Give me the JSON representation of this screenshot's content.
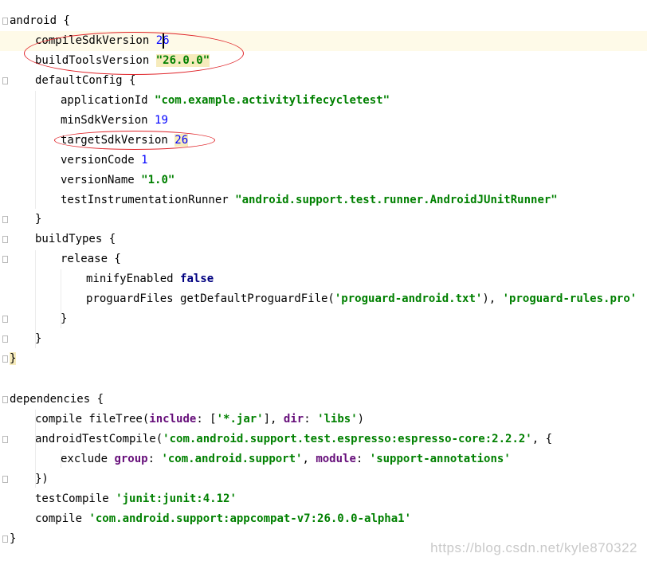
{
  "lines": [
    {
      "parts": [
        {
          "t": "android {"
        }
      ]
    },
    {
      "parts": [
        {
          "t": "compileSdkVersion "
        },
        {
          "t": "26",
          "c": "num"
        }
      ]
    },
    {
      "parts": [
        {
          "t": "buildToolsVersion "
        },
        {
          "t": "\"26.0.0\"",
          "c": "str hl"
        }
      ]
    },
    {
      "parts": [
        {
          "t": "defaultConfig {"
        }
      ]
    },
    {
      "parts": [
        {
          "t": "applicationId "
        },
        {
          "t": "\"com.example.activitylifecycletest\"",
          "c": "str"
        }
      ]
    },
    {
      "parts": [
        {
          "t": "minSdkVersion "
        },
        {
          "t": "19",
          "c": "num"
        }
      ]
    },
    {
      "parts": [
        {
          "t": "targetSdkVersion "
        },
        {
          "t": "26",
          "c": "num hln"
        }
      ]
    },
    {
      "parts": [
        {
          "t": "versionCode "
        },
        {
          "t": "1",
          "c": "num"
        }
      ]
    },
    {
      "parts": [
        {
          "t": "versionName "
        },
        {
          "t": "\"1.0\"",
          "c": "str"
        }
      ]
    },
    {
      "parts": [
        {
          "t": "testInstrumentationRunner "
        },
        {
          "t": "\"android.support.test.runner.AndroidJUnitRunner\"",
          "c": "str"
        }
      ]
    },
    {
      "parts": [
        {
          "t": "}"
        }
      ]
    },
    {
      "parts": [
        {
          "t": "buildTypes {"
        }
      ]
    },
    {
      "parts": [
        {
          "t": "release {"
        }
      ]
    },
    {
      "parts": [
        {
          "t": "minifyEnabled "
        },
        {
          "t": "false",
          "c": "kw"
        }
      ]
    },
    {
      "parts": [
        {
          "t": "proguardFiles getDefaultProguardFile("
        },
        {
          "t": "'proguard-android.txt'",
          "c": "str"
        },
        {
          "t": "), "
        },
        {
          "t": "'proguard-rules.pro'",
          "c": "str"
        }
      ]
    },
    {
      "parts": [
        {
          "t": "}"
        }
      ]
    },
    {
      "parts": [
        {
          "t": "}"
        }
      ]
    },
    {
      "parts": [
        {
          "t": "}",
          "c": "brace-hl"
        }
      ]
    },
    {
      "parts": []
    },
    {
      "parts": [
        {
          "t": "dependencies {"
        }
      ]
    },
    {
      "parts": [
        {
          "t": "compile fileTree("
        },
        {
          "t": "include",
          "c": "arg"
        },
        {
          "t": ": ["
        },
        {
          "t": "'*.jar'",
          "c": "str"
        },
        {
          "t": "], "
        },
        {
          "t": "dir",
          "c": "arg"
        },
        {
          "t": ": "
        },
        {
          "t": "'libs'",
          "c": "str"
        },
        {
          "t": ")"
        }
      ]
    },
    {
      "parts": [
        {
          "t": "androidTestCompile("
        },
        {
          "t": "'com.android.support.test.espresso:espresso-core:2.2.2'",
          "c": "str"
        },
        {
          "t": ", {"
        }
      ]
    },
    {
      "parts": [
        {
          "t": "exclude "
        },
        {
          "t": "group",
          "c": "arg"
        },
        {
          "t": ": "
        },
        {
          "t": "'com.android.support'",
          "c": "str"
        },
        {
          "t": ", "
        },
        {
          "t": "module",
          "c": "arg"
        },
        {
          "t": ": "
        },
        {
          "t": "'support-annotations'",
          "c": "str"
        }
      ]
    },
    {
      "parts": [
        {
          "t": "})"
        }
      ]
    },
    {
      "parts": [
        {
          "t": "testCompile "
        },
        {
          "t": "'junit:junit:4.12'",
          "c": "str"
        }
      ]
    },
    {
      "parts": [
        {
          "t": "compile "
        },
        {
          "t": "'com.android.support:appcompat-v7:26.0.0-alpha1'",
          "c": "str"
        }
      ]
    },
    {
      "parts": [
        {
          "t": "}"
        }
      ]
    }
  ],
  "watermark": "https://blog.csdn.net/kyle870322",
  "annotations": {
    "color": "#e0262b"
  }
}
